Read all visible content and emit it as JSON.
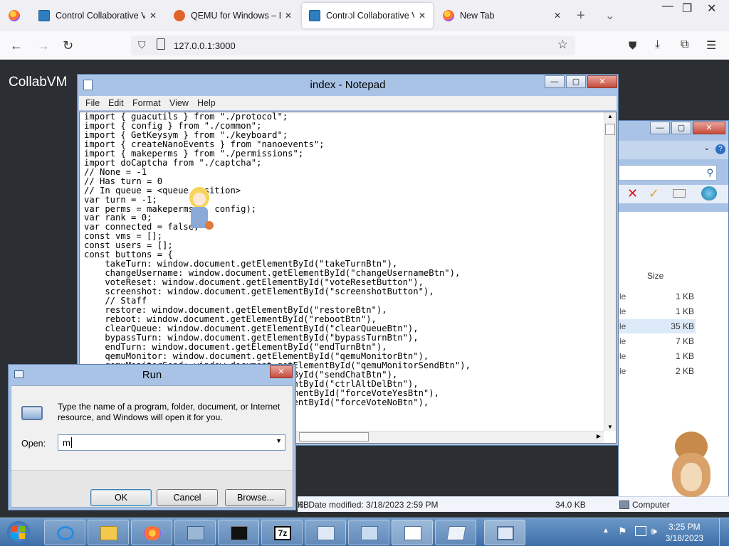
{
  "browser": {
    "tabs": [
      {
        "label": "Control Collaborative Vir",
        "icon": "monitor-icon",
        "active": false
      },
      {
        "label": "QEMU for Windows – Ins",
        "icon": "qemu-icon",
        "active": false
      },
      {
        "label": "Control Collaborative Vir",
        "icon": "monitor-icon",
        "active": true
      },
      {
        "label": "New Tab",
        "icon": "firefox-icon",
        "active": false
      }
    ],
    "url": "127.0.0.1:3000"
  },
  "page": {
    "brand": "CollabVM"
  },
  "notepad": {
    "title": "index - Notepad",
    "menu": [
      "File",
      "Edit",
      "Format",
      "View",
      "Help"
    ],
    "code": [
      "import { guacutils } from \"./protocol\";",
      "import { config } from \"./common\";",
      "import { GetKeysym } from \"./keyboard\";",
      "import { createNanoEvents } from \"nanoevents\";",
      "import { makeperms } from \"./permissions\";",
      "import doCaptcha from \"./captcha\";",
      "// None = -1",
      "// Has turn = 0",
      "// In queue = <queue position>",
      "var turn = -1;",
      "var perms = makeperms(0, config);",
      "var rank = 0;",
      "var connected = false;",
      "const vms = [];",
      "const users = [];",
      "const buttons = {",
      "    takeTurn: window.document.getElementById(\"takeTurnBtn\"),",
      "    changeUsername: window.document.getElementById(\"changeUsernameBtn\"),",
      "    voteReset: window.document.getElementById(\"voteResetButton\"),",
      "    screenshot: window.document.getElementById(\"screenshotButton\"),",
      "    // Staff",
      "    restore: window.document.getElementById(\"restoreBtn\"),",
      "    reboot: window.document.getElementById(\"rebootBtn\"),",
      "    clearQueue: window.document.getElementById(\"clearQueueBtn\"),",
      "    bypassTurn: window.document.getElementById(\"bypassTurnBtn\"),",
      "    endTurn: window.document.getElementById(\"endTurnBtn\"),",
      "    qemuMonitor: window.document.getElementById(\"qemuMonitorBtn\"),",
      "    qemuMonitorSend: window.document.getElementById(\"qemuMonitorSendBtn\"),",
      "    sendChat: window.document.getElementById(\"sendChatBtn\"),",
      "    ctrlAltDel: window.document.getElementById(\"ctrlAltDelBtn\"),",
      "    forceVoteYes: window.document.getElementById(\"forceVoteYesBtn\"),",
      "    forceVoteNo: window.document.getElementById(\"forceVoteNoBtn\"),"
    ]
  },
  "explorer": {
    "size_header": "Size",
    "rows": [
      {
        "type": "le",
        "size": "1 KB"
      },
      {
        "type": "le",
        "size": "1 KB"
      },
      {
        "type": "le",
        "size": "35 KB"
      },
      {
        "type": "le",
        "size": "7 KB"
      },
      {
        "type": "le",
        "size": "1 KB"
      },
      {
        "type": "le",
        "size": "2 KB"
      }
    ],
    "status": {
      "left": "KB",
      "date": "3, Date modified: 3/18/2023 2:59 PM",
      "size": "34.0 KB",
      "location": "Computer"
    }
  },
  "run": {
    "title": "Run",
    "description": "Type the name of a program, folder, document, or Internet resource, and Windows will open it for you.",
    "open_label": "Open:",
    "value": "m",
    "ok": "OK",
    "cancel": "Cancel",
    "browse": "Browse..."
  },
  "taskbar": {
    "time": "3:25 PM",
    "date": "3/18/2023"
  }
}
